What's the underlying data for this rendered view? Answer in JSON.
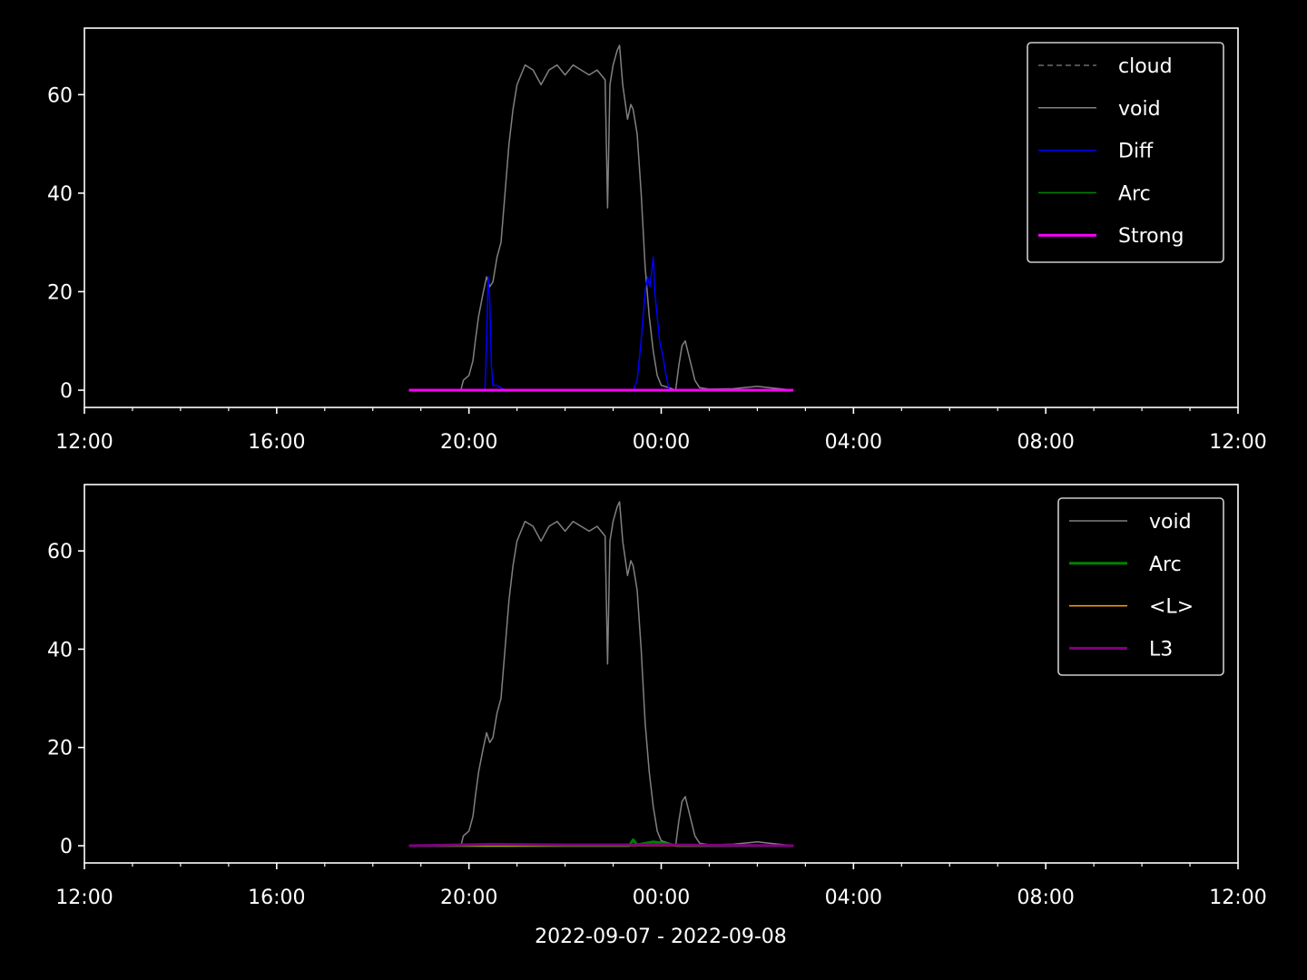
{
  "figure": {
    "background": "#000000",
    "xlabel": "2022-09-07 - 2022-09-08"
  },
  "chart_data": [
    {
      "type": "line",
      "xlim": [
        "2022-09-07 12:00",
        "2022-09-08 12:00"
      ],
      "ylim": [
        -3.5,
        73.5
      ],
      "xticks": [
        "12:00",
        "16:00",
        "20:00",
        "00:00",
        "04:00",
        "08:00",
        "12:00"
      ],
      "yticks": [
        0,
        20,
        40,
        60
      ],
      "grid": false,
      "legend_position": "upper right",
      "series": [
        {
          "name": "cloud",
          "color": "#808080",
          "style": "dashed",
          "width": 1.2,
          "points": []
        },
        {
          "name": "void",
          "color": "#808080",
          "style": "solid",
          "width": 1.5,
          "points": [
            [
              "19:50",
              0
            ],
            [
              "19:53",
              2
            ],
            [
              "20:00",
              3
            ],
            [
              "20:05",
              6
            ],
            [
              "20:08",
              10
            ],
            [
              "20:12",
              15
            ],
            [
              "20:18",
              20
            ],
            [
              "20:22",
              23
            ],
            [
              "20:26",
              21
            ],
            [
              "20:30",
              22
            ],
            [
              "20:35",
              27
            ],
            [
              "20:40",
              30
            ],
            [
              "20:45",
              40
            ],
            [
              "20:50",
              50
            ],
            [
              "20:55",
              57
            ],
            [
              "21:00",
              62
            ],
            [
              "21:05",
              64
            ],
            [
              "21:10",
              66
            ],
            [
              "21:20",
              65
            ],
            [
              "21:30",
              62
            ],
            [
              "21:40",
              65
            ],
            [
              "21:50",
              66
            ],
            [
              "22:00",
              64
            ],
            [
              "22:10",
              66
            ],
            [
              "22:20",
              65
            ],
            [
              "22:30",
              64
            ],
            [
              "22:40",
              65
            ],
            [
              "22:50",
              63
            ],
            [
              "22:53",
              37
            ],
            [
              "22:56",
              62
            ],
            [
              "23:00",
              66
            ],
            [
              "23:05",
              69
            ],
            [
              "23:08",
              70
            ],
            [
              "23:12",
              62
            ],
            [
              "23:18",
              55
            ],
            [
              "23:22",
              58
            ],
            [
              "23:25",
              57
            ],
            [
              "23:30",
              52
            ],
            [
              "23:35",
              40
            ],
            [
              "23:40",
              25
            ],
            [
              "23:45",
              15
            ],
            [
              "23:50",
              8
            ],
            [
              "23:55",
              3
            ],
            [
              "00:00",
              1
            ],
            [
              "00:10",
              0.5
            ],
            [
              "00:18",
              0
            ],
            [
              "00:22",
              5
            ],
            [
              "00:26",
              9
            ],
            [
              "00:30",
              10
            ],
            [
              "00:36",
              6
            ],
            [
              "00:42",
              2
            ],
            [
              "00:48",
              0.5
            ],
            [
              "01:00",
              0.2
            ],
            [
              "01:30",
              0.3
            ],
            [
              "02:00",
              0.8
            ],
            [
              "02:15",
              0.5
            ],
            [
              "02:45",
              0
            ]
          ]
        },
        {
          "name": "Diff",
          "color": "#0000ff",
          "style": "solid",
          "width": 1.5,
          "points": [
            [
              "18:45",
              0
            ],
            [
              "20:20",
              0
            ],
            [
              "20:22",
              10
            ],
            [
              "20:24",
              23
            ],
            [
              "20:26",
              18
            ],
            [
              "20:28",
              5
            ],
            [
              "20:30",
              1
            ],
            [
              "20:35",
              1
            ],
            [
              "20:45",
              0
            ],
            [
              "23:25",
              0
            ],
            [
              "23:30",
              2
            ],
            [
              "23:35",
              10
            ],
            [
              "23:40",
              20
            ],
            [
              "23:43",
              23
            ],
            [
              "23:46",
              21
            ],
            [
              "23:48",
              24
            ],
            [
              "23:50",
              27
            ],
            [
              "23:52",
              20
            ],
            [
              "23:55",
              15
            ],
            [
              "23:58",
              10
            ],
            [
              "00:02",
              7
            ],
            [
              "00:06",
              3
            ],
            [
              "00:10",
              0
            ],
            [
              "02:45",
              0
            ]
          ]
        },
        {
          "name": "Arc",
          "color": "#008000",
          "style": "solid",
          "width": 1.5,
          "points": [
            [
              "18:45",
              0
            ],
            [
              "02:45",
              0
            ]
          ]
        },
        {
          "name": "Strong",
          "color": "#ff00ff",
          "style": "solid",
          "width": 3,
          "points": [
            [
              "18:45",
              0
            ],
            [
              "02:45",
              0
            ]
          ]
        }
      ]
    },
    {
      "type": "line",
      "xlim": [
        "2022-09-07 12:00",
        "2022-09-08 12:00"
      ],
      "ylim": [
        -3.5,
        73.5
      ],
      "xticks": [
        "12:00",
        "16:00",
        "20:00",
        "00:00",
        "04:00",
        "08:00",
        "12:00"
      ],
      "yticks": [
        0,
        20,
        40,
        60
      ],
      "grid": false,
      "legend_position": "upper right",
      "series": [
        {
          "name": "void",
          "color": "#808080",
          "style": "solid",
          "width": 1.5,
          "points": [
            [
              "19:50",
              0
            ],
            [
              "19:53",
              2
            ],
            [
              "20:00",
              3
            ],
            [
              "20:05",
              6
            ],
            [
              "20:08",
              10
            ],
            [
              "20:12",
              15
            ],
            [
              "20:18",
              20
            ],
            [
              "20:22",
              23
            ],
            [
              "20:26",
              21
            ],
            [
              "20:30",
              22
            ],
            [
              "20:35",
              27
            ],
            [
              "20:40",
              30
            ],
            [
              "20:45",
              40
            ],
            [
              "20:50",
              50
            ],
            [
              "20:55",
              57
            ],
            [
              "21:00",
              62
            ],
            [
              "21:05",
              64
            ],
            [
              "21:10",
              66
            ],
            [
              "21:20",
              65
            ],
            [
              "21:30",
              62
            ],
            [
              "21:40",
              65
            ],
            [
              "21:50",
              66
            ],
            [
              "22:00",
              64
            ],
            [
              "22:10",
              66
            ],
            [
              "22:20",
              65
            ],
            [
              "22:30",
              64
            ],
            [
              "22:40",
              65
            ],
            [
              "22:50",
              63
            ],
            [
              "22:53",
              37
            ],
            [
              "22:56",
              62
            ],
            [
              "23:00",
              66
            ],
            [
              "23:05",
              69
            ],
            [
              "23:08",
              70
            ],
            [
              "23:12",
              62
            ],
            [
              "23:18",
              55
            ],
            [
              "23:22",
              58
            ],
            [
              "23:25",
              57
            ],
            [
              "23:30",
              52
            ],
            [
              "23:35",
              40
            ],
            [
              "23:40",
              25
            ],
            [
              "23:45",
              15
            ],
            [
              "23:50",
              8
            ],
            [
              "23:55",
              3
            ],
            [
              "00:00",
              1
            ],
            [
              "00:10",
              0.5
            ],
            [
              "00:18",
              0
            ],
            [
              "00:22",
              5
            ],
            [
              "00:26",
              9
            ],
            [
              "00:30",
              10
            ],
            [
              "00:36",
              6
            ],
            [
              "00:42",
              2
            ],
            [
              "00:48",
              0.5
            ],
            [
              "01:00",
              0.2
            ],
            [
              "01:30",
              0.3
            ],
            [
              "02:00",
              0.8
            ],
            [
              "02:15",
              0.5
            ],
            [
              "02:45",
              0
            ]
          ]
        },
        {
          "name": "Arc",
          "color": "#008000",
          "style": "solid",
          "width": 3,
          "points": [
            [
              "18:45",
              0
            ],
            [
              "23:20",
              0
            ],
            [
              "23:25",
              1.2
            ],
            [
              "23:30",
              0.2
            ],
            [
              "23:40",
              0.5
            ],
            [
              "23:50",
              0.8
            ],
            [
              "00:00",
              0.6
            ],
            [
              "00:10",
              0.3
            ],
            [
              "00:20",
              0
            ],
            [
              "02:45",
              0
            ]
          ]
        },
        {
          "name": "<L>",
          "color": "#ffa500",
          "style": "solid",
          "width": 1.5,
          "points": [
            [
              "18:45",
              0
            ],
            [
              "02:45",
              0
            ]
          ]
        },
        {
          "name": "L3",
          "color": "#800080",
          "style": "solid",
          "width": 3,
          "points": [
            [
              "18:45",
              0
            ],
            [
              "20:30",
              0.3
            ],
            [
              "22:00",
              0.2
            ],
            [
              "23:00",
              0.2
            ],
            [
              "00:00",
              0.2
            ],
            [
              "02:45",
              0
            ]
          ]
        }
      ]
    }
  ]
}
